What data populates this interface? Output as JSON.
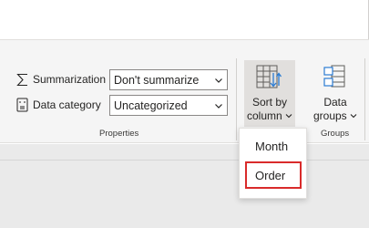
{
  "properties": {
    "group_label": "Properties",
    "summarization": {
      "label": "Summarization",
      "value": "Don't summarize",
      "icon": "sigma-icon"
    },
    "data_category": {
      "label": "Data category",
      "value": "Uncategorized",
      "icon": "data-category-icon"
    }
  },
  "sort": {
    "line1": "Sort by",
    "line2": "column",
    "icon": "sort-by-column-icon"
  },
  "groups": {
    "group_label": "Groups",
    "line1": "Data",
    "line2": "groups",
    "icon": "data-groups-icon"
  },
  "sort_menu": {
    "items": [
      "Month",
      "Order"
    ],
    "highlighted": "Order",
    "highlight_color": "#d92b2b"
  },
  "colors": {
    "ribbon": "#f5f5f5",
    "accent": "#d92b2b",
    "icon_blue": "#2b7cd3"
  }
}
